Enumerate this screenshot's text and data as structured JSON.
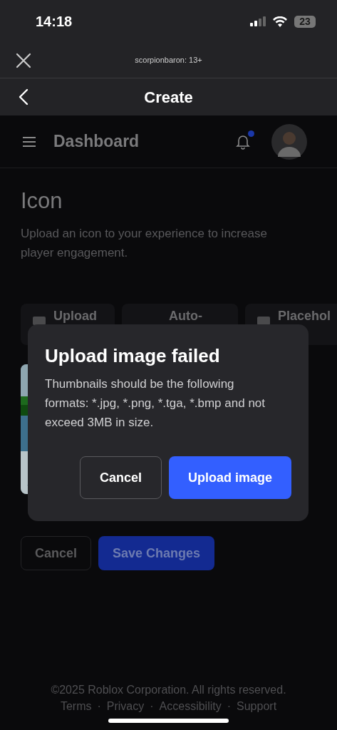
{
  "status_bar": {
    "time": "14:18",
    "battery": "23"
  },
  "sheet_header": {
    "title": "scorpionbaron: 13+"
  },
  "nav_bar": {
    "title": "Create"
  },
  "dashboard_bar": {
    "title": "Dashboard",
    "notification_dot": true
  },
  "section": {
    "title": "Icon",
    "description": "Upload an icon to your experience to increase player engagement."
  },
  "tabs": [
    {
      "label": "Upload",
      "selected": false
    },
    {
      "label": "Auto-",
      "selected": false
    },
    {
      "label": "Placehol",
      "selected": false
    }
  ],
  "form_buttons": [
    {
      "label": "Cancel",
      "kind": "secondary"
    },
    {
      "label": "Save Changes",
      "kind": "primary"
    }
  ],
  "footer": {
    "copyright": "©2025 Roblox Corporation. All rights reserved.",
    "separator": "·",
    "links": [
      "Terms",
      "Privacy",
      "Accessibility",
      "Support"
    ]
  },
  "dialog": {
    "title": "Upload image failed",
    "message": "Thumbnails should be the following formats: *.jpg, *.png, *.tga, *.bmp and not exceed 3MB in size.",
    "buttons": [
      {
        "label": "Cancel",
        "kind": "secondary"
      },
      {
        "label": "Upload image",
        "kind": "primary"
      }
    ]
  }
}
